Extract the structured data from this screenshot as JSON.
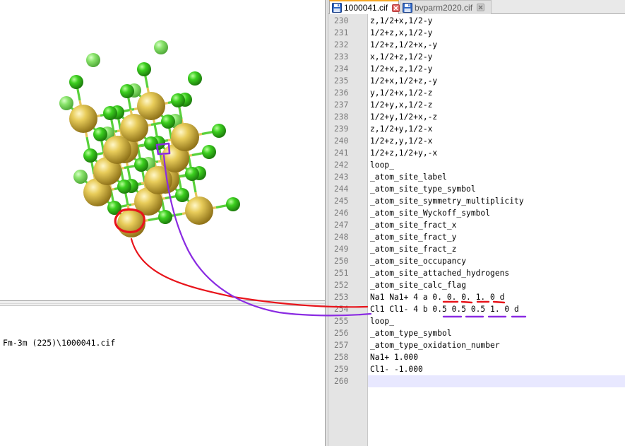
{
  "viewer": {
    "space_group_path": "Fm-3m (225)\\1000041.cif"
  },
  "editor": {
    "tabs": [
      {
        "label": "1000041.cif",
        "active": true
      },
      {
        "label": "bvparm2020.cif",
        "active": false
      }
    ],
    "current_line": 260,
    "lines": [
      {
        "number": "230",
        "text": "z,1/2+x,1/2-y"
      },
      {
        "number": "231",
        "text": "1/2+z,x,1/2-y"
      },
      {
        "number": "232",
        "text": "1/2+z,1/2+x,-y"
      },
      {
        "number": "233",
        "text": "x,1/2+z,1/2-y"
      },
      {
        "number": "234",
        "text": "1/2+x,z,1/2-y"
      },
      {
        "number": "235",
        "text": "1/2+x,1/2+z,-y"
      },
      {
        "number": "236",
        "text": "y,1/2+x,1/2-z"
      },
      {
        "number": "237",
        "text": "1/2+y,x,1/2-z"
      },
      {
        "number": "238",
        "text": "1/2+y,1/2+x,-z"
      },
      {
        "number": "239",
        "text": "z,1/2+y,1/2-x"
      },
      {
        "number": "240",
        "text": "1/2+z,y,1/2-x"
      },
      {
        "number": "241",
        "text": "1/2+z,1/2+y,-x"
      },
      {
        "number": "242",
        "text": "loop_"
      },
      {
        "number": "243",
        "text": "_atom_site_label"
      },
      {
        "number": "244",
        "text": "_atom_site_type_symbol"
      },
      {
        "number": "245",
        "text": "_atom_site_symmetry_multiplicity"
      },
      {
        "number": "246",
        "text": "_atom_site_Wyckoff_symbol"
      },
      {
        "number": "247",
        "text": "_atom_site_fract_x"
      },
      {
        "number": "248",
        "text": "_atom_site_fract_y"
      },
      {
        "number": "249",
        "text": "_atom_site_fract_z"
      },
      {
        "number": "250",
        "text": "_atom_site_occupancy"
      },
      {
        "number": "251",
        "text": "_atom_site_attached_hydrogens"
      },
      {
        "number": "252",
        "text": "_atom_site_calc_flag"
      },
      {
        "number": "253",
        "text": "Na1 Na1+ 4 a 0. 0. 0. 1. 0 d"
      },
      {
        "number": "254",
        "text": "Cl1 Cl1- 4 b 0.5 0.5 0.5 1. 0 d"
      },
      {
        "number": "255",
        "text": "loop_"
      },
      {
        "number": "256",
        "text": "_atom_type_symbol"
      },
      {
        "number": "257",
        "text": "_atom_type_oxidation_number"
      },
      {
        "number": "258",
        "text": "Na1+ 1.000"
      },
      {
        "number": "259",
        "text": "Cl1- -1.000"
      },
      {
        "number": "260",
        "text": ""
      }
    ]
  },
  "colors": {
    "sodium_atom": "#d4b23a",
    "chlorine_atom": "#35b81e",
    "annotation_red": "#e8141b",
    "annotation_purple": "#8a2be2",
    "active_tab_accent": "#f6a623",
    "current_line_highlight": "#e8e8ff"
  },
  "icons": {
    "tab_file": "floppy-disk-icon",
    "tab_close": "close-icon"
  }
}
